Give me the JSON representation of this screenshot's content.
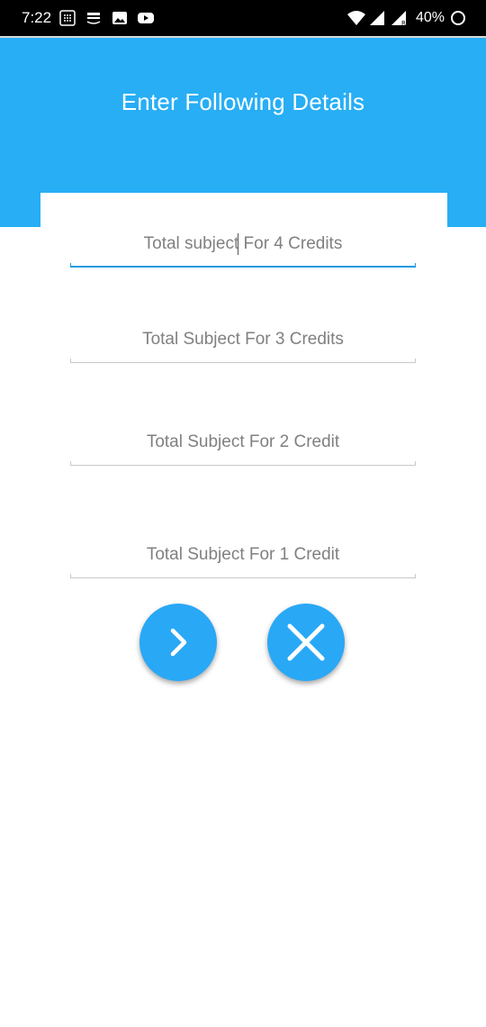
{
  "status_bar": {
    "time": "7:22",
    "battery": "40%",
    "icons": [
      "keypad-icon",
      "amazon-icon",
      "image-icon",
      "youtube-icon",
      "wifi-icon",
      "signal-icon",
      "signal-roaming-icon",
      "battery-ring-icon"
    ]
  },
  "header": {
    "title": "Enter Following Details",
    "color": "#27aef5"
  },
  "form": {
    "fields": [
      {
        "placeholder": "Total subject For 4 Credits",
        "value": "",
        "focused": true
      },
      {
        "placeholder": "Total Subject For 3 Credits",
        "value": ""
      },
      {
        "placeholder": "Total Subject For 2 Credit",
        "value": ""
      },
      {
        "placeholder": "Total Subject For 1 Credit",
        "value": ""
      }
    ]
  },
  "actions": {
    "next_icon": "chevron-right-icon",
    "cancel_icon": "close-icon",
    "color": "#29a8f6"
  }
}
